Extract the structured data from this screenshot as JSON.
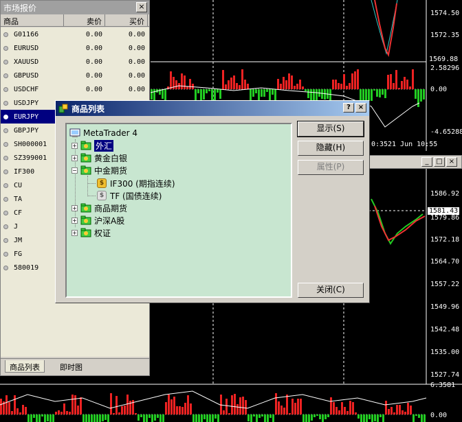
{
  "market_watch": {
    "title": "市场报价",
    "columns": {
      "symbol": "商品",
      "bid": "卖价",
      "ask": "买价"
    },
    "rows": [
      {
        "symbol": "G01166",
        "bid": "0.00",
        "ask": "0.00",
        "selected": false
      },
      {
        "symbol": "EURUSD",
        "bid": "0.00",
        "ask": "0.00",
        "selected": false
      },
      {
        "symbol": "XAUUSD",
        "bid": "0.00",
        "ask": "0.00",
        "selected": false
      },
      {
        "symbol": "GBPUSD",
        "bid": "0.00",
        "ask": "0.00",
        "selected": false
      },
      {
        "symbol": "USDCHF",
        "bid": "0.00",
        "ask": "0.00",
        "selected": false
      },
      {
        "symbol": "USDJPY",
        "bid": "",
        "ask": "",
        "selected": false
      },
      {
        "symbol": "EURJPY",
        "bid": "",
        "ask": "",
        "selected": true
      },
      {
        "symbol": "GBPJPY",
        "bid": "",
        "ask": "",
        "selected": false
      },
      {
        "symbol": "SH000001",
        "bid": "",
        "ask": "",
        "selected": false
      },
      {
        "symbol": "SZ399001",
        "bid": "",
        "ask": "",
        "selected": false
      },
      {
        "symbol": "IF300",
        "bid": "",
        "ask": "",
        "selected": false
      },
      {
        "symbol": "CU",
        "bid": "",
        "ask": "",
        "selected": false
      },
      {
        "symbol": "TA",
        "bid": "",
        "ask": "",
        "selected": false
      },
      {
        "symbol": "CF",
        "bid": "",
        "ask": "",
        "selected": false
      },
      {
        "symbol": "J",
        "bid": "",
        "ask": "",
        "selected": false
      },
      {
        "symbol": "JM",
        "bid": "",
        "ask": "",
        "selected": false
      },
      {
        "symbol": "FG",
        "bid": "",
        "ask": "",
        "selected": false
      },
      {
        "symbol": "580019",
        "bid": "",
        "ask": "",
        "selected": false
      }
    ],
    "tabs": {
      "symbols": "商品列表",
      "tick_chart": "即时图"
    }
  },
  "dialog": {
    "title": "商品列表",
    "help_label": "?",
    "close_label": "×",
    "tree": {
      "root": "MetaTrader 4",
      "forex": "外汇",
      "gold_silver": "黄金白银",
      "cn_futures": "中金期货",
      "if300": "IF300 (期指连续)",
      "tf": "TF (国债连续)",
      "commodity_futures": "商品期货",
      "sh_sz_a": "沪深A股",
      "warrants": "权证"
    },
    "buttons": {
      "show": "显示(S)",
      "hide": "隐藏(H)",
      "properties": "属性(P)",
      "close": "关闭(C)"
    }
  },
  "chart_axes": {
    "top_prices": [
      "1574.50",
      "1572.35",
      "1569.88"
    ],
    "top_osc": [
      "2.58296",
      "0.00",
      "-4.65288"
    ],
    "top_time": "21 Jun 10:55",
    "top_time_partial": "0:35",
    "mid_prices": [
      "1586.92",
      "1581.43",
      "1579.86",
      "1572.18",
      "1564.70",
      "1557.22",
      "1549.96",
      "1542.48",
      "1535.00",
      "1527.74"
    ],
    "bottom_osc": [
      "6.3581",
      "0.00"
    ]
  },
  "colors": {
    "selection": "#000080",
    "tree_bg": "#c8e6d0",
    "list_bg": "#ebe9d8",
    "title_gradient_start": "#0a246a"
  }
}
